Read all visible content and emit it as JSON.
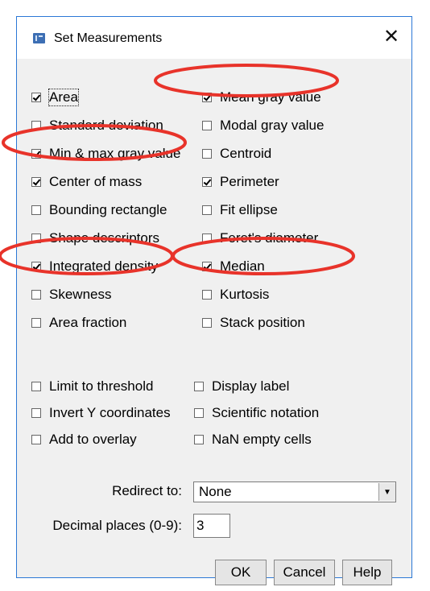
{
  "window": {
    "title": "Set Measurements",
    "close_glyph": "✕"
  },
  "measurements": [
    {
      "label": "Area",
      "checked": true,
      "focused": true
    },
    {
      "label": "Mean gray value",
      "checked": true
    },
    {
      "label": "Standard deviation",
      "checked": false
    },
    {
      "label": "Modal gray value",
      "checked": false
    },
    {
      "label": "Min & max gray value",
      "checked": true
    },
    {
      "label": "Centroid",
      "checked": false
    },
    {
      "label": "Center of mass",
      "checked": true
    },
    {
      "label": "Perimeter",
      "checked": true
    },
    {
      "label": "Bounding rectangle",
      "checked": false
    },
    {
      "label": "Fit ellipse",
      "checked": false
    },
    {
      "label": "Shape descriptors",
      "checked": false
    },
    {
      "label": "Feret's diameter",
      "checked": false
    },
    {
      "label": "Integrated density",
      "checked": true
    },
    {
      "label": "Median",
      "checked": true
    },
    {
      "label": "Skewness",
      "checked": false
    },
    {
      "label": "Kurtosis",
      "checked": false
    },
    {
      "label": "Area fraction",
      "checked": false
    },
    {
      "label": "Stack position",
      "checked": false
    }
  ],
  "options": [
    {
      "label": "Limit to threshold",
      "checked": false
    },
    {
      "label": "Display label",
      "checked": false
    },
    {
      "label": "Invert Y coordinates",
      "checked": false
    },
    {
      "label": "Scientific notation",
      "checked": false
    },
    {
      "label": "Add to overlay",
      "checked": false
    },
    {
      "label": "NaN empty cells",
      "checked": false
    }
  ],
  "redirect": {
    "label": "Redirect to:",
    "value": "None"
  },
  "decimal": {
    "label": "Decimal places (0-9):",
    "value": "3"
  },
  "buttons": {
    "ok": "OK",
    "cancel": "Cancel",
    "help": "Help"
  },
  "colors": {
    "annotation_red": "#e8332a",
    "window_border": "#2b78d6",
    "app_icon": "#3d6fb4"
  }
}
